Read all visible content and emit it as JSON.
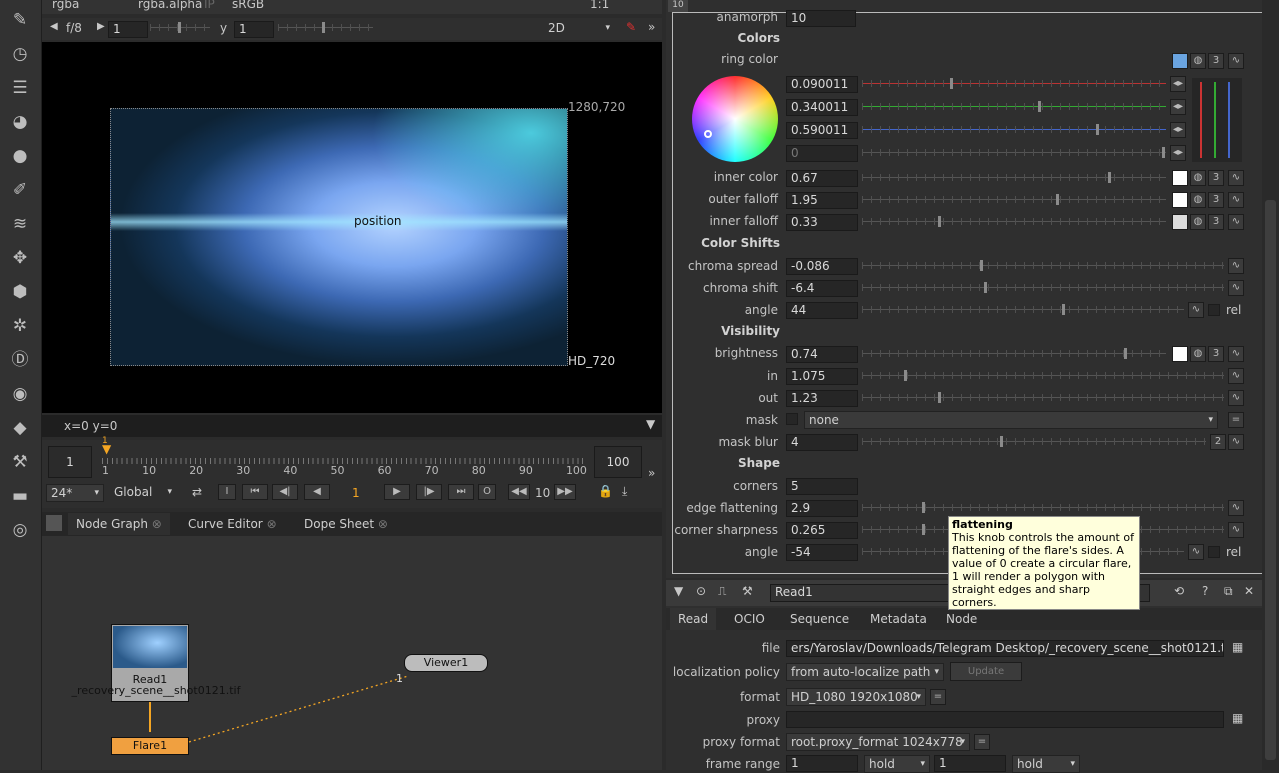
{
  "viewer": {
    "top_channels": "rgba",
    "top_alpha": "rgba.alpha",
    "top_ip": "IP",
    "top_colorspace": "sRGB",
    "top_zoom": "1:1",
    "fstop": "f/8",
    "gain": "1",
    "gamma_label": "y",
    "gamma": "1",
    "mode": "2D",
    "res_top": "1280,720",
    "format_label": "HD_720",
    "overlay_label": "position",
    "coords": "x=0 y=0"
  },
  "timeline": {
    "start": "1",
    "end": "100",
    "current": "1",
    "ticks": [
      "1",
      "10",
      "20",
      "30",
      "40",
      "50",
      "60",
      "70",
      "80",
      "90",
      "100"
    ],
    "fps": "24*",
    "scope": "Global",
    "frame_display": "1",
    "step": "10"
  },
  "panel_tabs": {
    "node_graph": "Node Graph",
    "curve_editor": "Curve Editor",
    "dope_sheet": "Dope Sheet"
  },
  "nodes": {
    "read": "Read1",
    "read_file": "_recovery_scene__shot0121.tif",
    "flare": "Flare1",
    "viewer": "Viewer1",
    "viewer_input": "1"
  },
  "props": {
    "top_num": "10",
    "anamorph_label": "anamorph",
    "anamorph_value": "10",
    "colors_header": "Colors",
    "ring_color": "ring color",
    "rgb": [
      "0.090011",
      "0.340011",
      "0.590011",
      "0"
    ],
    "count_3": "3",
    "inner_color": "inner color",
    "inner_color_v": "0.67",
    "outer_falloff": "outer falloff",
    "outer_falloff_v": "1.95",
    "inner_falloff": "inner falloff",
    "inner_falloff_v": "0.33",
    "color_shifts": "Color Shifts",
    "chroma_spread": "chroma spread",
    "chroma_spread_v": "-0.086",
    "chroma_shift": "chroma shift",
    "chroma_shift_v": "-6.4",
    "angle": "angle",
    "angle_v": "44",
    "rel": "rel",
    "visibility": "Visibility",
    "brightness": "brightness",
    "brightness_v": "0.74",
    "in": "in",
    "in_v": "1.075",
    "out": "out",
    "out_v": "1.23",
    "mask": "mask",
    "mask_v": "none",
    "mask_blur": "mask blur",
    "mask_blur_v": "4",
    "mask_blur_btn": "2",
    "shape": "Shape",
    "corners": "corners",
    "corners_v": "5",
    "edge_flattening": "edge flattening",
    "edge_flattening_v": "2.9",
    "corner_sharpness": "corner sharpness",
    "corner_sharpness_v": "0.265",
    "angle2": "angle",
    "angle2_v": "-54",
    "rel2": "rel"
  },
  "tooltip": {
    "title": "flattening",
    "body": "This knob controls the amount of flattening of the flare's sides. A value of 0 create a circular flare, 1 will render a polygon with straight edges and sharp corners."
  },
  "read_panel": {
    "name": "Read1",
    "tabs": [
      "Read",
      "OCIO",
      "Sequence",
      "Metadata",
      "Node"
    ],
    "file_label": "file",
    "file_v": "ers/Yaroslav/Downloads/Telegram Desktop/_recovery_scene__shot0121.tif",
    "loc_label": "localization policy",
    "loc_v": "from auto-localize path",
    "update": "Update",
    "format_label": "format",
    "format_v": "HD_1080 1920x1080",
    "proxy_label": "proxy",
    "proxy_format_label": "proxy format",
    "proxy_format_v": "root.proxy_format 1024x778",
    "frame_range_label": "frame range",
    "fr_start": "1",
    "fr_start_mode": "hold",
    "fr_end": "1",
    "fr_end_mode": "hold",
    "equals": "="
  },
  "colors": {
    "accent": "#f5a623",
    "flare_node": "#f0a040",
    "read_node": "#a9a9a9",
    "tooltip_bg": "#ffffdc"
  }
}
